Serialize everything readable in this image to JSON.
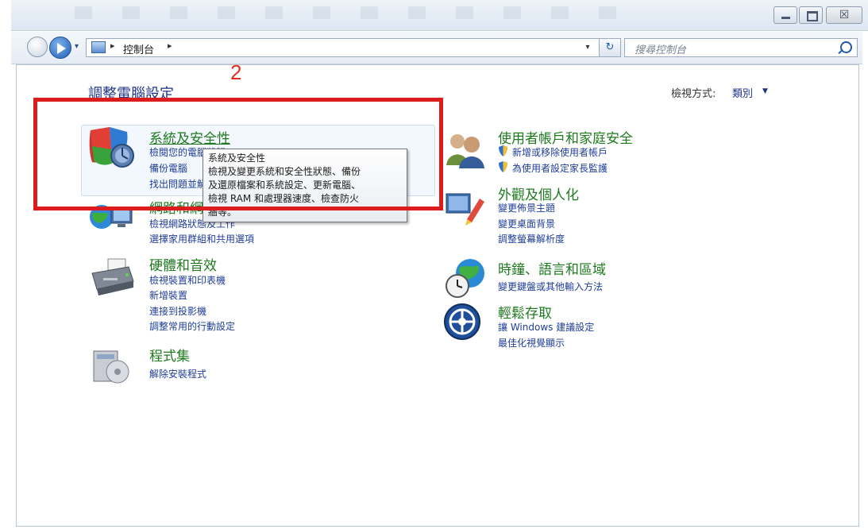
{
  "window": {
    "minimize_glyph": "",
    "maximize_glyph": "",
    "close_glyph": "☒"
  },
  "address": {
    "breadcrumb": "控制台",
    "separator": "▸",
    "dropdown": "▾",
    "refresh_glyph": "↻"
  },
  "search": {
    "placeholder": "搜尋控制台"
  },
  "page": {
    "title": "調整電腦設定",
    "annotation": "2",
    "view_by_label": "檢視方式:",
    "view_by_value": "類別",
    "view_by_arrow": "▼"
  },
  "categories_left": [
    {
      "title": "系統及安全性",
      "links": [
        "檢閱您的電腦狀態",
        "備份電腦",
        "找出問題並解決"
      ]
    },
    {
      "title": "網路和網際網路",
      "links": [
        "檢視網路狀態及工作",
        "選擇家用群組和共用選項"
      ]
    },
    {
      "title": "硬體和音效",
      "links": [
        "檢視裝置和印表機",
        "新增裝置",
        "連接到投影機",
        "調整常用的行動設定"
      ]
    },
    {
      "title": "程式集",
      "links": [
        "解除安裝程式"
      ]
    }
  ],
  "categories_right": [
    {
      "title": "使用者帳戶和家庭安全",
      "links": [
        "新增或移除使用者帳戶",
        "為使用者設定家長監護"
      ]
    },
    {
      "title": "外觀及個人化",
      "links": [
        "變更佈景主題",
        "變更桌面背景",
        "調整螢幕解析度"
      ]
    },
    {
      "title": "時鐘、語言和區域",
      "links": [
        "變更鍵盤或其他輸入方法"
      ]
    },
    {
      "title": "輕鬆存取",
      "links": [
        "讓 Windows 建議設定",
        "最佳化視覺顯示"
      ]
    }
  ],
  "tooltip": {
    "lines": [
      "系統及安全性",
      "檢視及變更系統和安全性狀態、備份",
      "及還原檔案和系統設定、更新電腦、",
      "檢視 RAM 和處理器速度、檢查防火",
      "牆等。"
    ]
  },
  "colors": {
    "category_green": "#1f7a1f",
    "link_blue": "#1f3d99",
    "annotation_red": "#dc1c1c"
  }
}
